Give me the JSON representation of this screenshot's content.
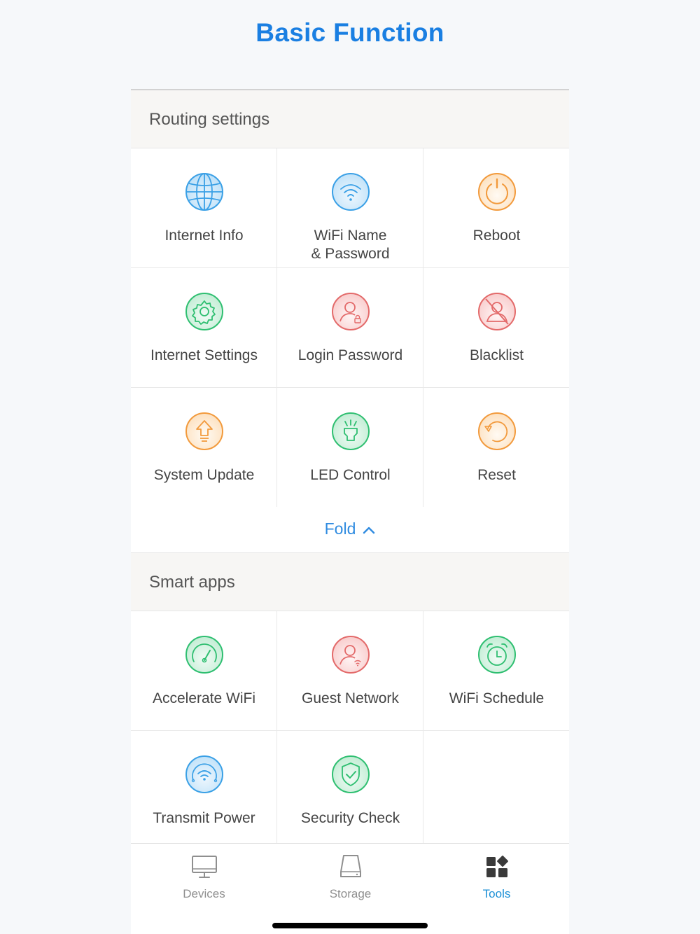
{
  "page": {
    "title": "Basic Function"
  },
  "routing": {
    "header": "Routing settings",
    "items": [
      {
        "label": "Internet Info",
        "icon": "globe-icon"
      },
      {
        "label": "WiFi Name\n& Password",
        "icon": "wifi-icon"
      },
      {
        "label": "Reboot",
        "icon": "power-icon"
      },
      {
        "label": "Internet Settings",
        "icon": "gear-icon"
      },
      {
        "label": "Login Password",
        "icon": "user-lock-icon"
      },
      {
        "label": "Blacklist",
        "icon": "user-blocked-icon"
      },
      {
        "label": "System Update",
        "icon": "upload-icon"
      },
      {
        "label": "LED Control",
        "icon": "led-light-icon"
      },
      {
        "label": "Reset",
        "icon": "reset-icon"
      }
    ],
    "fold_label": "Fold"
  },
  "smart": {
    "header": "Smart apps",
    "items": [
      {
        "label": "Accelerate WiFi",
        "icon": "speedometer-icon"
      },
      {
        "label": "Guest Network",
        "icon": "guest-user-icon"
      },
      {
        "label": "WiFi Schedule",
        "icon": "alarm-clock-icon"
      },
      {
        "label": "Transmit Power",
        "icon": "signal-power-icon"
      },
      {
        "label": "Security Check",
        "icon": "shield-check-icon"
      }
    ]
  },
  "tabbar": {
    "tabs": [
      {
        "label": "Devices",
        "icon": "monitor-icon",
        "active": false
      },
      {
        "label": "Storage",
        "icon": "hard-drive-icon",
        "active": false
      },
      {
        "label": "Tools",
        "icon": "tools-grid-icon",
        "active": true
      }
    ]
  },
  "colors": {
    "title": "#1a7fe2",
    "blue": "#3aa0e6",
    "orange": "#f29a3c",
    "green": "#2fbf71",
    "red": "#e36a6a",
    "active_tab": "#1a8fd6"
  }
}
